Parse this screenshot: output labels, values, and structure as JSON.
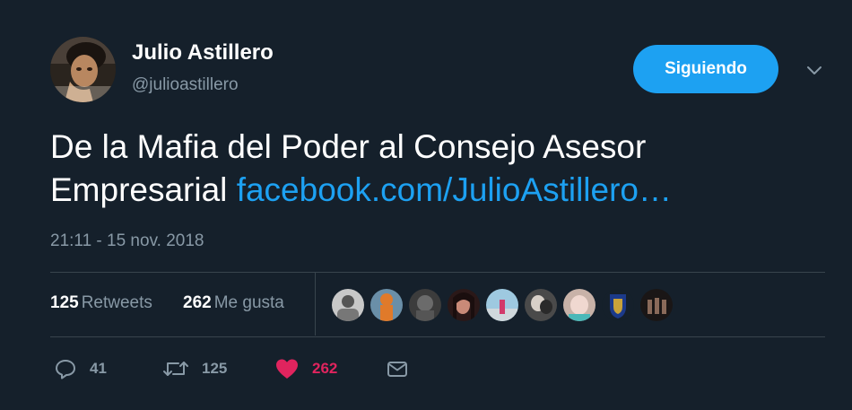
{
  "user": {
    "name": "Julio Astillero",
    "handle": "@julioastillero"
  },
  "follow_button": "Siguiendo",
  "tweet": {
    "text": "De la Mafia del Poder al Consejo Asesor Empresarial",
    "link_text": "facebook.com/JulioAstillero…",
    "timestamp": "21:11 - 15 nov. 2018"
  },
  "stats": {
    "retweets_count": "125",
    "retweets_label": "Retweets",
    "likes_count": "262",
    "likes_label": "Me gusta"
  },
  "actions": {
    "replies": "41",
    "retweets": "125",
    "likes": "262"
  },
  "colors": {
    "background": "#15202b",
    "accent": "#1da1f2",
    "like": "#e0245e",
    "muted_text": "#8899a6",
    "divider": "#38444d"
  },
  "icons": [
    "chevron-down-icon",
    "reply-icon",
    "retweet-icon",
    "heart-icon",
    "message-icon"
  ]
}
